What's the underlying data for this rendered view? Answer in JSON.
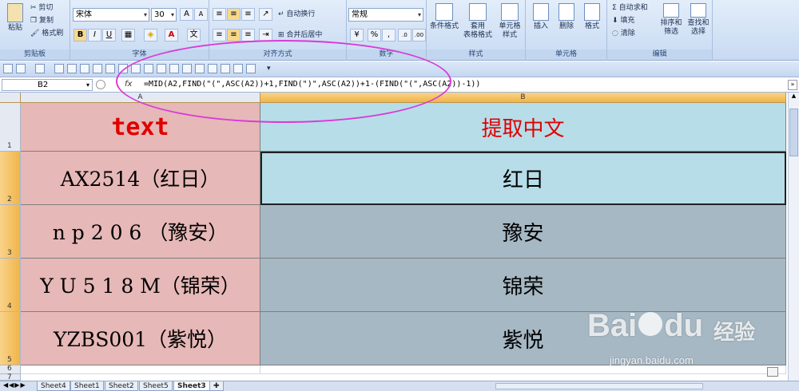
{
  "ribbon": {
    "clipboard": {
      "group_label": "剪贴板",
      "paste": "粘贴",
      "cut": "剪切",
      "copy": "复制",
      "format_painter": "格式刷"
    },
    "font": {
      "group_label": "字体",
      "font_name": "宋体",
      "font_size": "30",
      "bold": "B",
      "italic": "I",
      "underline": "U"
    },
    "alignment": {
      "group_label": "对齐方式",
      "wrap_text": "自动换行",
      "merge_center": "合并后居中"
    },
    "number": {
      "group_label": "数字",
      "format": "常规",
      "percent": "%",
      "comma": ","
    },
    "styles": {
      "group_label": "样式",
      "conditional": "条件格式",
      "table_format": "套用\n表格格式",
      "cell_styles": "单元格\n样式"
    },
    "cells": {
      "group_label": "单元格",
      "insert": "插入",
      "delete": "删除",
      "format": "格式"
    },
    "editing": {
      "group_label": "编辑",
      "autosum": "自动求和",
      "fill": "填充",
      "clear": "清除",
      "sort_filter": "排序和\n筛选",
      "find_select": "查找和\n选择"
    }
  },
  "formula_bar": {
    "name_box": "B2",
    "fx": "fx",
    "formula": "=MID(A2,FIND(\"(\",ASC(A2))+1,FIND(\")\",ASC(A2))+1-(FIND(\"(\",ASC(A2))-1))"
  },
  "columns": [
    "A",
    "B"
  ],
  "rows": [
    {
      "num": "1",
      "a": "text",
      "b": "提取中文"
    },
    {
      "num": "2",
      "a": "AX2514（红日）",
      "b": "红日"
    },
    {
      "num": "3",
      "a": "n p 2 0 6 （豫安）",
      "b": "豫安"
    },
    {
      "num": "4",
      "a": "Y U 5 1 8 M（锦荣）",
      "b": "锦荣"
    },
    {
      "num": "5",
      "a": "YZBS001（紫悦）",
      "b": "紫悦"
    },
    {
      "num": "6",
      "a": "",
      "b": ""
    },
    {
      "num": "7",
      "a": "",
      "b": ""
    }
  ],
  "sheet_tabs": [
    "Sheet4",
    "Sheet1",
    "Sheet2",
    "Sheet5",
    "Sheet3"
  ],
  "active_tab": "Sheet3",
  "watermark": {
    "brand": "Bai",
    "brand2": "du",
    "cn": "经验",
    "url": "jingyan.baidu.com"
  },
  "colors": {
    "header_text": "#e00000",
    "col_a_fill": "#e6b8b7",
    "b1_fill": "#b7dde8",
    "b_fill": "#a6b8c4",
    "oval": "#d83bd8"
  }
}
